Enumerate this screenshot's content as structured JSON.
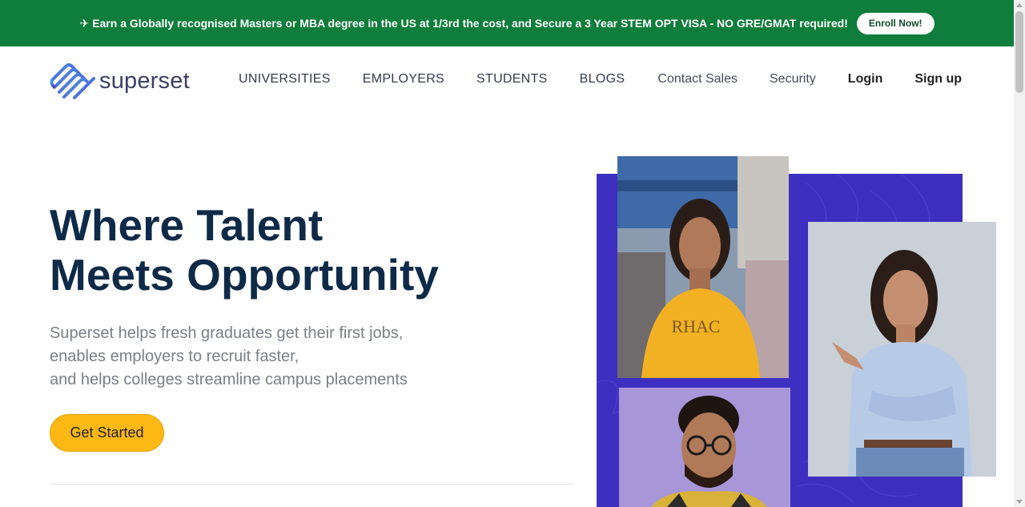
{
  "banner": {
    "icon": "airplane-icon",
    "text": "Earn a Globally recognised Masters or MBA degree in the US at 1/3rd the cost, and Secure a 3 Year STEM OPT VISA - NO GRE/GMAT required!",
    "button": "Enroll Now!"
  },
  "nav": {
    "logo": "superset",
    "links": [
      "UNIVERSITIES",
      "EMPLOYERS",
      "STUDENTS",
      "BLOGS"
    ],
    "contact_sales": "Contact Sales",
    "security": "Security",
    "login": "Login",
    "signup": "Sign up"
  },
  "hero": {
    "title_line1": "Where Talent",
    "title_line2": "Meets Opportunity",
    "sub_line1": "Superset helps fresh graduates get their first jobs,",
    "sub_line2": "enables employers to recruit faster,",
    "sub_line3": "and helps colleges streamline campus placements",
    "cta": "Get Started"
  },
  "colors": {
    "banner_bg": "#0f7d3b",
    "heading": "#0e2a47",
    "cta_bg": "#fdb813",
    "collage_bg": "#3d2fbf"
  }
}
